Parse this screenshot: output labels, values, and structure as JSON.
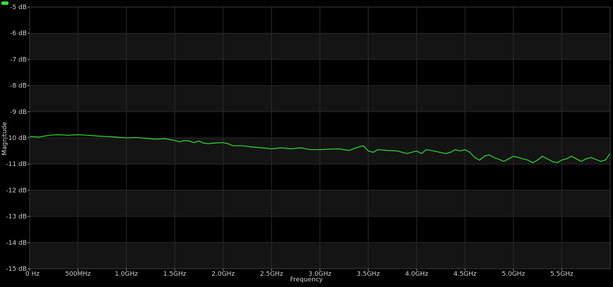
{
  "chart_data": {
    "type": "line",
    "title": "",
    "xlabel": "Frequency",
    "ylabel": "Magnitude",
    "xlim": [
      0,
      6000
    ],
    "ylim": [
      -15,
      -5
    ],
    "x_unit": "MHz",
    "grid": true,
    "x_ticks": [
      0,
      500,
      1000,
      1500,
      2000,
      2500,
      3000,
      3500,
      4000,
      4500,
      5000,
      5500
    ],
    "x_tick_labels": [
      "0 Hz",
      "500MHz",
      "1.0GHz",
      "1.5GHz",
      "2.0GHz",
      "2.5GHz",
      "3.0GHz",
      "3.5GHz",
      "4.0GHz",
      "4.5GHz",
      "5.0GHz",
      "5.5GHz"
    ],
    "y_ticks": [
      -5,
      -6,
      -7,
      -8,
      -9,
      -10,
      -11,
      -12,
      -13,
      -14,
      -15
    ],
    "y_tick_labels": [
      "-5 dB",
      "-6 dB",
      "-7 dB",
      "-8 dB",
      "-9 dB",
      "-10 dB",
      "-11 dB",
      "-12 dB",
      "-13 dB",
      "-14 dB",
      "-15 dB"
    ],
    "series": [
      {
        "color": "#33dd33",
        "x": [
          0,
          100,
          200,
          300,
          400,
          500,
          600,
          700,
          800,
          900,
          1000,
          1100,
          1200,
          1300,
          1400,
          1500,
          1550,
          1600,
          1650,
          1700,
          1750,
          1800,
          1850,
          1900,
          2000,
          2050,
          2100,
          2200,
          2300,
          2400,
          2500,
          2600,
          2700,
          2800,
          2900,
          3000,
          3100,
          3200,
          3300,
          3400,
          3450,
          3500,
          3550,
          3600,
          3700,
          3800,
          3900,
          4000,
          4050,
          4100,
          4200,
          4300,
          4350,
          4400,
          4450,
          4500,
          4550,
          4600,
          4650,
          4700,
          4750,
          4800,
          4850,
          4900,
          4950,
          5000,
          5050,
          5100,
          5150,
          5200,
          5250,
          5300,
          5350,
          5400,
          5450,
          5500,
          5550,
          5600,
          5650,
          5700,
          5750,
          5800,
          5850,
          5900,
          5950,
          6000
        ],
        "values": [
          -9.95,
          -9.97,
          -9.9,
          -9.88,
          -9.9,
          -9.88,
          -9.9,
          -9.93,
          -9.95,
          -9.97,
          -10.0,
          -9.98,
          -10.02,
          -10.05,
          -10.03,
          -10.1,
          -10.15,
          -10.1,
          -10.12,
          -10.18,
          -10.12,
          -10.2,
          -10.22,
          -10.2,
          -10.18,
          -10.22,
          -10.3,
          -10.3,
          -10.35,
          -10.38,
          -10.42,
          -10.38,
          -10.42,
          -10.38,
          -10.45,
          -10.45,
          -10.43,
          -10.42,
          -10.48,
          -10.35,
          -10.3,
          -10.5,
          -10.55,
          -10.45,
          -10.48,
          -10.5,
          -10.6,
          -10.5,
          -10.6,
          -10.45,
          -10.52,
          -10.6,
          -10.55,
          -10.45,
          -10.5,
          -10.45,
          -10.55,
          -10.75,
          -10.85,
          -10.7,
          -10.65,
          -10.75,
          -10.82,
          -10.9,
          -10.8,
          -10.7,
          -10.75,
          -10.8,
          -10.85,
          -10.95,
          -10.85,
          -10.7,
          -10.8,
          -10.9,
          -10.95,
          -10.85,
          -10.8,
          -10.7,
          -10.8,
          -10.9,
          -10.8,
          -10.75,
          -10.82,
          -10.9,
          -10.85,
          -10.6
        ]
      }
    ]
  }
}
